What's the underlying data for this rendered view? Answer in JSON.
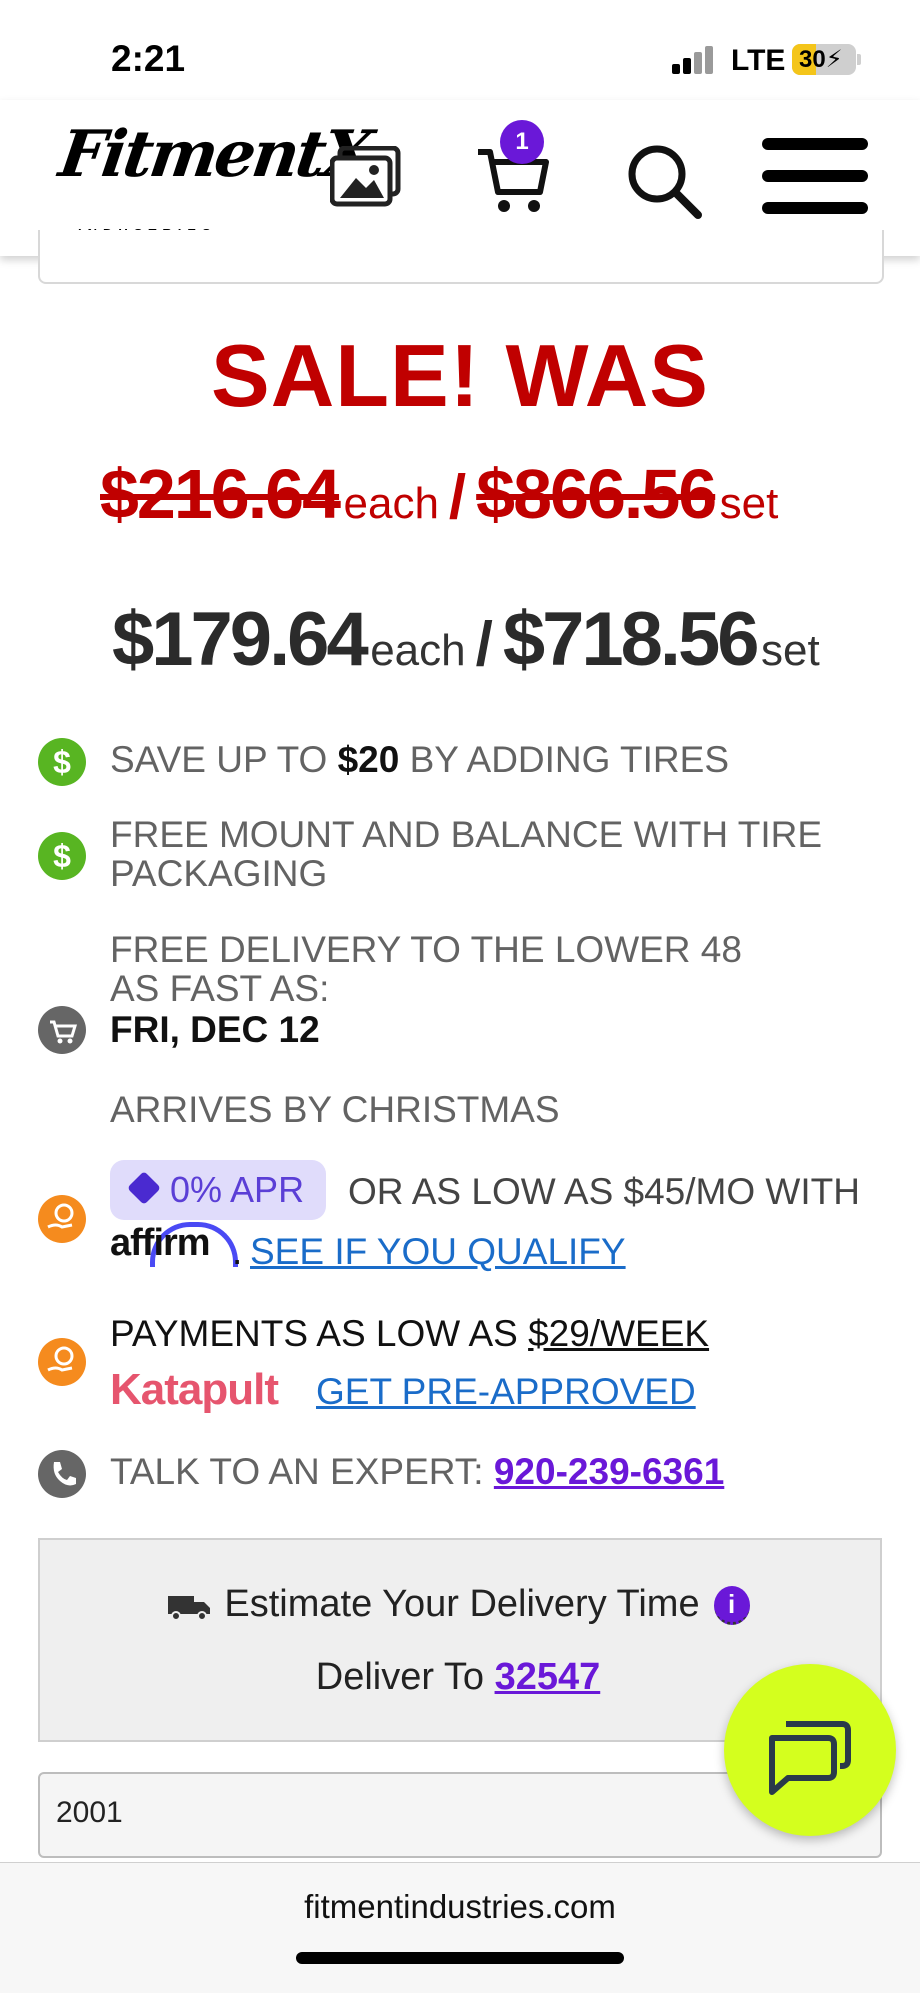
{
  "status_bar": {
    "time": "2:21",
    "network": "LTE",
    "battery": "30"
  },
  "header": {
    "logo_text": "FitmentX",
    "logo_sub": "INDUSTRIES",
    "cart_count": "1"
  },
  "pricing": {
    "sale_heading": "SALE! WAS",
    "was_each": "$216.64",
    "was_set": "$866.56",
    "now_each": "$179.64",
    "now_set": "$718.56",
    "each_label": "each",
    "set_label": "set",
    "slash": "/"
  },
  "features": {
    "tires_pre": "SAVE UP TO ",
    "tires_amount": "$20",
    "tires_post": " BY ADDING TIRES",
    "mount_line1": "FREE MOUNT AND BALANCE WITH TIRE",
    "mount_line2": "PACKAGING",
    "delivery_line1": "FREE DELIVERY TO THE LOWER 48",
    "delivery_line2": "AS FAST AS:",
    "delivery_date": "FRI, DEC 12",
    "christmas": "ARRIVES BY CHRISTMAS",
    "apr_badge": "0% APR",
    "affirm_text": "OR AS LOW AS $45/MO WITH",
    "affirm_logo": "affirm",
    "affirm_link": "SEE IF YOU QUALIFY",
    "katapult_pre": "PAYMENTS AS LOW AS ",
    "katapult_amount": "$29/WEEK",
    "katapult_logo": "Katapult",
    "katapult_link": "GET PRE-APPROVED",
    "expert_label": "TALK TO AN EXPERT: ",
    "expert_phone": "920-239-6361"
  },
  "estimate": {
    "title": "Estimate Your Delivery Time",
    "deliver_label": "Deliver To ",
    "zip": "32547"
  },
  "year_select": {
    "value": "2001"
  },
  "browser": {
    "url": "fitmentindustries.com"
  },
  "colors": {
    "sale_red": "#c00000",
    "brand_purple": "#6a18d8",
    "chat_lime": "#d4ff1e",
    "money_green": "#58b522"
  }
}
